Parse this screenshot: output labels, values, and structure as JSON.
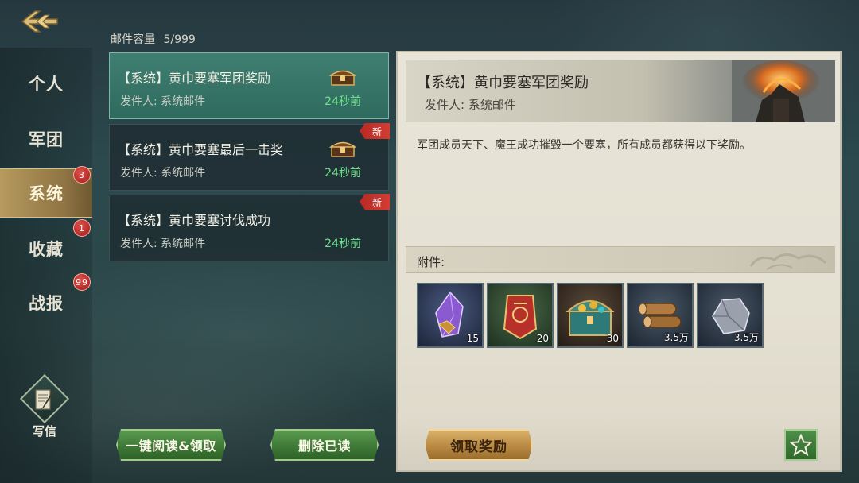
{
  "nav": {
    "items": [
      {
        "label": "个人",
        "badge": ""
      },
      {
        "label": "军团",
        "badge": ""
      },
      {
        "label": "系统",
        "badge": "3"
      },
      {
        "label": "收藏",
        "badge": "1"
      },
      {
        "label": "战报",
        "badge": "99"
      }
    ],
    "write_label": "写信"
  },
  "mailbox": {
    "capacity_label": "邮件容量",
    "capacity_value": "5/999",
    "mails": [
      {
        "title": "【系统】黄巾要塞军团奖励",
        "sender": "发件人: 系统邮件",
        "time": "24秒前",
        "new": "",
        "has_attachment": true
      },
      {
        "title": "【系统】黄巾要塞最后一击奖",
        "sender": "发件人: 系统邮件",
        "time": "24秒前",
        "new": "新",
        "has_attachment": true
      },
      {
        "title": "【系统】黄巾要塞讨伐成功",
        "sender": "发件人: 系统邮件",
        "time": "24秒前",
        "new": "新",
        "has_attachment": false
      }
    ],
    "read_claim_all": "一键阅读&领取",
    "delete_read": "删除已读"
  },
  "detail": {
    "title": "【系统】黄巾要塞军团奖励",
    "sender": "发件人: 系统邮件",
    "body": "军团成员天下、魔王成功摧毁一个要塞，所有成员都获得以下奖励。",
    "attachment_label": "附件:",
    "items": [
      {
        "icon": "purple-crystal-icon",
        "count": "15"
      },
      {
        "icon": "red-banner-scroll-icon",
        "count": "20"
      },
      {
        "icon": "treasure-chest-icon",
        "count": "30"
      },
      {
        "icon": "wood-logs-icon",
        "count": "3.5万"
      },
      {
        "icon": "stone-ore-icon",
        "count": "3.5万"
      }
    ],
    "claim_label": "领取奖励"
  },
  "colors": {
    "selected_mail": "#3f7f72",
    "time_green": "#6ee08a",
    "active_nav": "#b69a5e",
    "badge_red": "#c0302a"
  }
}
